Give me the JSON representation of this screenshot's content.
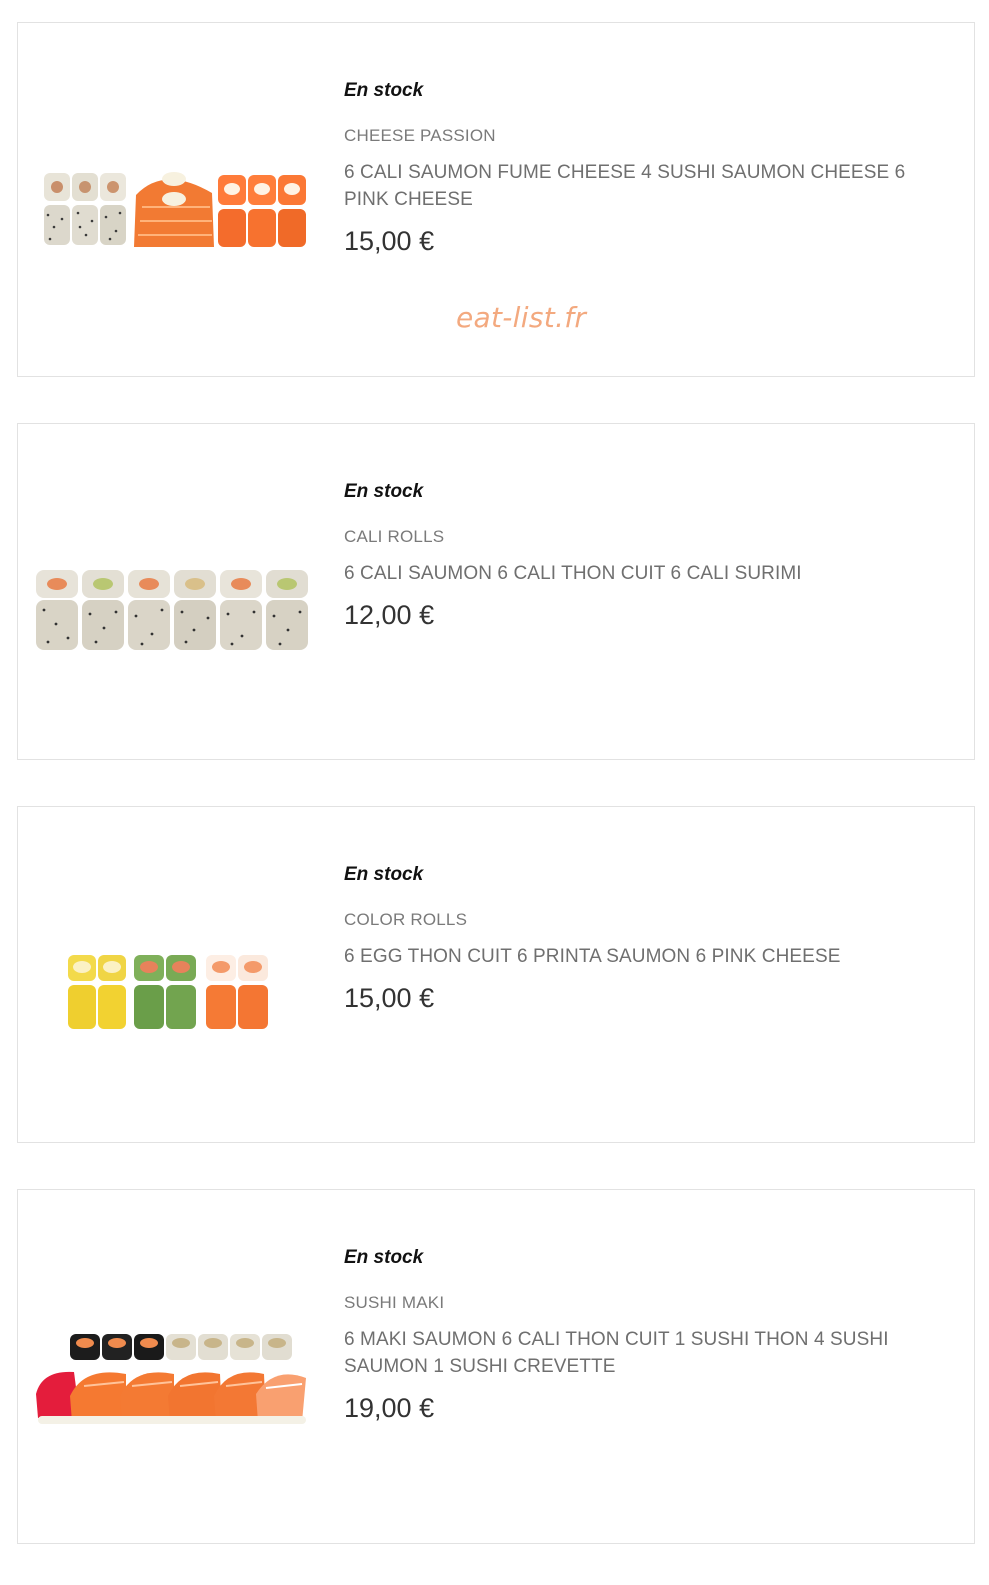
{
  "watermark": "eat-list.fr",
  "products": [
    {
      "stock": "En stock",
      "category": "CHEESE PASSION",
      "description": "6 CALI SAUMON FUME CHEESE 4 SUSHI SAUMON CHEESE 6 PINK CHEESE",
      "price": "15,00 €",
      "image": "sushi-cheese-passion-image"
    },
    {
      "stock": "En stock",
      "category": "CALI ROLLS",
      "description": "6 CALI SAUMON 6 CALI THON CUIT 6 CALI SURIMI",
      "price": "12,00 €",
      "image": "cali-rolls-image"
    },
    {
      "stock": "En stock",
      "category": "COLOR ROLLS",
      "description": "6 EGG THON CUIT 6 PRINTA SAUMON 6 PINK CHEESE",
      "price": "15,00 €",
      "image": "color-rolls-image"
    },
    {
      "stock": "En stock",
      "category": "SUSHI MAKI",
      "description": "6 MAKI SAUMON 6 CALI THON CUIT 1 SUSHI THON 4 SUSHI SAUMON 1 SUSHI CREVETTE",
      "price": "19,00 €",
      "image": "sushi-maki-image"
    }
  ],
  "colors": {
    "border": "#e2e2e2",
    "category": "#7a7a7a",
    "description": "#6f6f6f",
    "price": "#333333",
    "watermark": "#f3a97f"
  }
}
